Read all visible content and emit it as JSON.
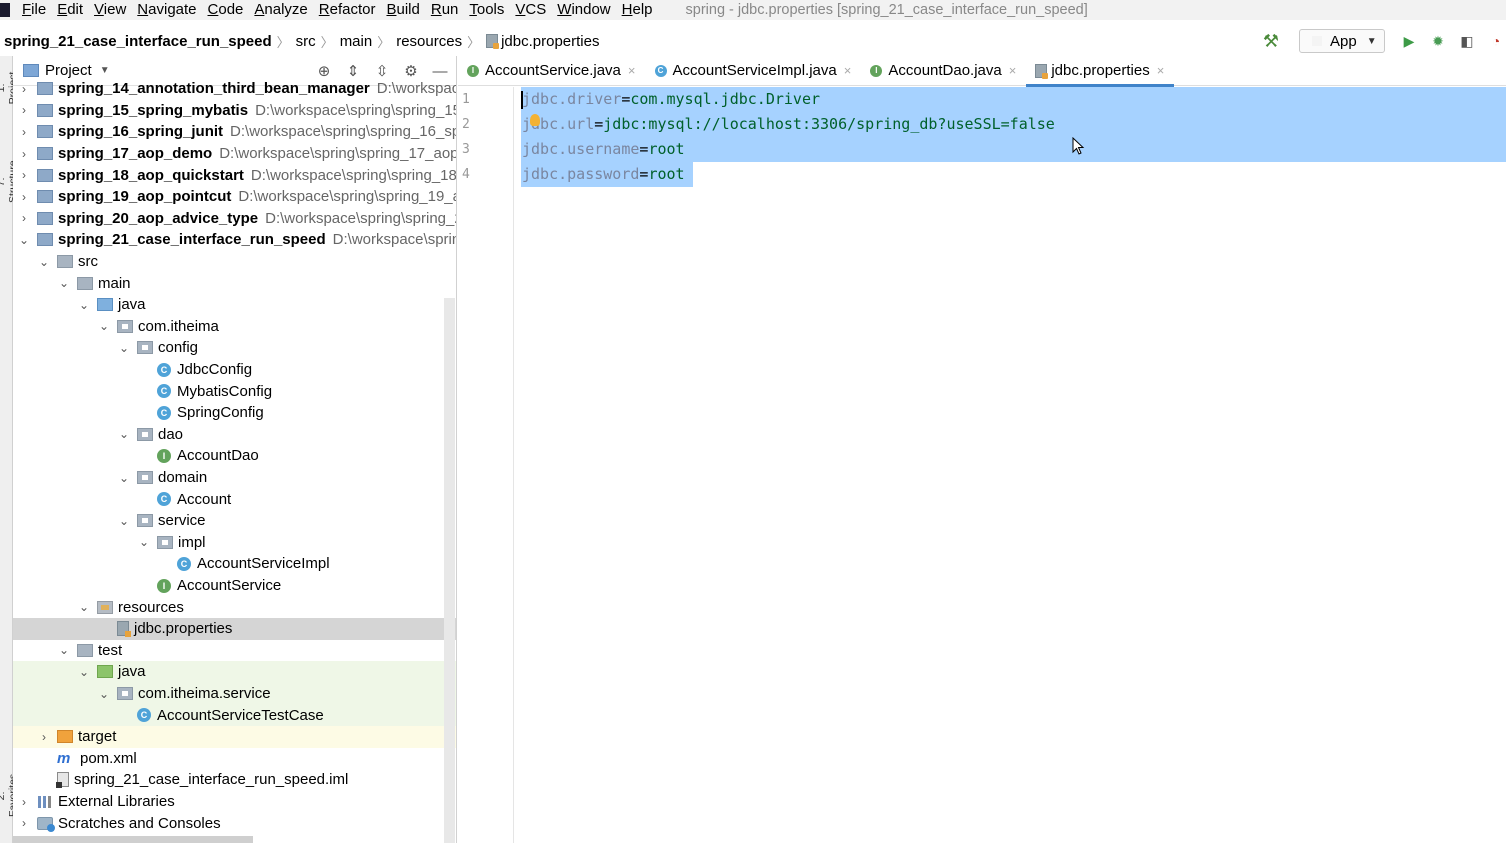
{
  "menu": {
    "items": [
      "File",
      "Edit",
      "View",
      "Navigate",
      "Code",
      "Analyze",
      "Refactor",
      "Build",
      "Run",
      "Tools",
      "VCS",
      "Window",
      "Help"
    ],
    "window_title": "spring - jdbc.properties [spring_21_case_interface_run_speed]"
  },
  "breadcrumb": {
    "project": "spring_21_case_interface_run_speed",
    "parts": [
      "src",
      "main",
      "resources"
    ],
    "file": "jdbc.properties"
  },
  "toolbar": {
    "run_config": "App"
  },
  "left_strip": {
    "project": "1: Project",
    "structure": "7: Structure",
    "favorites": "2: Favorites"
  },
  "project_panel": {
    "title": "Project",
    "tree": [
      {
        "label": "spring_14_annotation_third_bean_manager",
        "path": "D:\\workspace\\spring\\spring_14",
        "depth": 0,
        "arrow": "›",
        "icon": "module",
        "bold": true
      },
      {
        "label": "spring_15_spring_mybatis",
        "path": "D:\\workspace\\spring\\spring_15",
        "depth": 0,
        "arrow": "›",
        "icon": "module",
        "bold": true
      },
      {
        "label": "spring_16_spring_junit",
        "path": "D:\\workspace\\spring\\spring_16_spr",
        "depth": 0,
        "arrow": "›",
        "icon": "module",
        "bold": true
      },
      {
        "label": "spring_17_aop_demo",
        "path": "D:\\workspace\\spring\\spring_17_aop_",
        "depth": 0,
        "arrow": "›",
        "icon": "module",
        "bold": true
      },
      {
        "label": "spring_18_aop_quickstart",
        "path": "D:\\workspace\\spring\\spring_18_",
        "depth": 0,
        "arrow": "›",
        "icon": "module",
        "bold": true
      },
      {
        "label": "spring_19_aop_pointcut",
        "path": "D:\\workspace\\spring\\spring_19_ac",
        "depth": 0,
        "arrow": "›",
        "icon": "module",
        "bold": true
      },
      {
        "label": "spring_20_aop_advice_type",
        "path": "D:\\workspace\\spring\\spring_2(",
        "depth": 0,
        "arrow": "›",
        "icon": "module",
        "bold": true
      },
      {
        "label": "spring_21_case_interface_run_speed",
        "path": "D:\\workspace\\spring\\",
        "depth": 0,
        "arrow": "⌄",
        "icon": "module",
        "bold": true
      },
      {
        "label": "src",
        "path": "",
        "depth": 1,
        "arrow": "⌄",
        "icon": "folder",
        "bold": false
      },
      {
        "label": "main",
        "path": "",
        "depth": 2,
        "arrow": "⌄",
        "icon": "folder",
        "bold": false
      },
      {
        "label": "java",
        "path": "",
        "depth": 3,
        "arrow": "⌄",
        "icon": "folder-blue",
        "bold": false
      },
      {
        "label": "com.itheima",
        "path": "",
        "depth": 4,
        "arrow": "⌄",
        "icon": "pkg",
        "bold": false
      },
      {
        "label": "config",
        "path": "",
        "depth": 5,
        "arrow": "⌄",
        "icon": "pkg",
        "bold": false
      },
      {
        "label": "JdbcConfig",
        "path": "",
        "depth": 6,
        "arrow": "",
        "icon": "cls",
        "bold": false
      },
      {
        "label": "MybatisConfig",
        "path": "",
        "depth": 6,
        "arrow": "",
        "icon": "cls",
        "bold": false
      },
      {
        "label": "SpringConfig",
        "path": "",
        "depth": 6,
        "arrow": "",
        "icon": "cls",
        "bold": false
      },
      {
        "label": "dao",
        "path": "",
        "depth": 5,
        "arrow": "⌄",
        "icon": "pkg",
        "bold": false
      },
      {
        "label": "AccountDao",
        "path": "",
        "depth": 6,
        "arrow": "",
        "icon": "intf",
        "bold": false
      },
      {
        "label": "domain",
        "path": "",
        "depth": 5,
        "arrow": "⌄",
        "icon": "pkg",
        "bold": false
      },
      {
        "label": "Account",
        "path": "",
        "depth": 6,
        "arrow": "",
        "icon": "cls",
        "bold": false
      },
      {
        "label": "service",
        "path": "",
        "depth": 5,
        "arrow": "⌄",
        "icon": "pkg",
        "bold": false
      },
      {
        "label": "impl",
        "path": "",
        "depth": 6,
        "arrow": "⌄",
        "icon": "pkg",
        "bold": false
      },
      {
        "label": "AccountServiceImpl",
        "path": "",
        "depth": 7,
        "arrow": "",
        "icon": "cls",
        "bold": false
      },
      {
        "label": "AccountService",
        "path": "",
        "depth": 6,
        "arrow": "",
        "icon": "intf",
        "bold": false
      },
      {
        "label": "resources",
        "path": "",
        "depth": 3,
        "arrow": "⌄",
        "icon": "folder-res",
        "bold": false
      },
      {
        "label": "jdbc.properties",
        "path": "",
        "depth": 4,
        "arrow": "",
        "icon": "prop",
        "bold": false,
        "selected": true
      },
      {
        "label": "test",
        "path": "",
        "depth": 2,
        "arrow": "⌄",
        "icon": "folder",
        "bold": false
      },
      {
        "label": "java",
        "path": "",
        "depth": 3,
        "arrow": "⌄",
        "icon": "folder-green",
        "bold": false,
        "test": true
      },
      {
        "label": "com.itheima.service",
        "path": "",
        "depth": 4,
        "arrow": "⌄",
        "icon": "pkg",
        "bold": false,
        "test": true
      },
      {
        "label": "AccountServiceTestCase",
        "path": "",
        "depth": 5,
        "arrow": "",
        "icon": "test",
        "bold": false,
        "test": true
      },
      {
        "label": "target",
        "path": "",
        "depth": 1,
        "arrow": "›",
        "icon": "folder-orange",
        "bold": false,
        "target": true
      },
      {
        "label": "pom.xml",
        "path": "",
        "depth": 1,
        "arrow": "",
        "icon": "xml",
        "bold": false
      },
      {
        "label": "spring_21_case_interface_run_speed.iml",
        "path": "",
        "depth": 1,
        "arrow": "",
        "icon": "iml",
        "bold": false
      },
      {
        "label": "External Libraries",
        "path": "",
        "depth": 0,
        "arrow": "›",
        "icon": "lib",
        "bold": false
      },
      {
        "label": "Scratches and Consoles",
        "path": "",
        "depth": 0,
        "arrow": "›",
        "icon": "scratch",
        "bold": false
      }
    ]
  },
  "editor": {
    "tabs": [
      {
        "label": "AccountService.java",
        "icon": "I",
        "active": false
      },
      {
        "label": "AccountServiceImpl.java",
        "icon": "C",
        "active": false
      },
      {
        "label": "AccountDao.java",
        "icon": "I",
        "active": false
      },
      {
        "label": "jdbc.properties",
        "icon": "prop",
        "active": true
      }
    ],
    "line_numbers": [
      "1",
      "2",
      "3",
      "4"
    ],
    "lines": [
      {
        "key": "jdbc.driver",
        "eq": "=",
        "value": "com.mysql.jdbc.Driver"
      },
      {
        "key": "jdbc.url",
        "eq": "=",
        "value": "jdbc:mysql://localhost:3306/spring_db?useSSL=false"
      },
      {
        "key": "jdbc.username",
        "eq": "=",
        "value": "root"
      },
      {
        "key": "jdbc.password",
        "eq": "=",
        "value": "root"
      }
    ],
    "selection_color": "#a6d2ff"
  }
}
